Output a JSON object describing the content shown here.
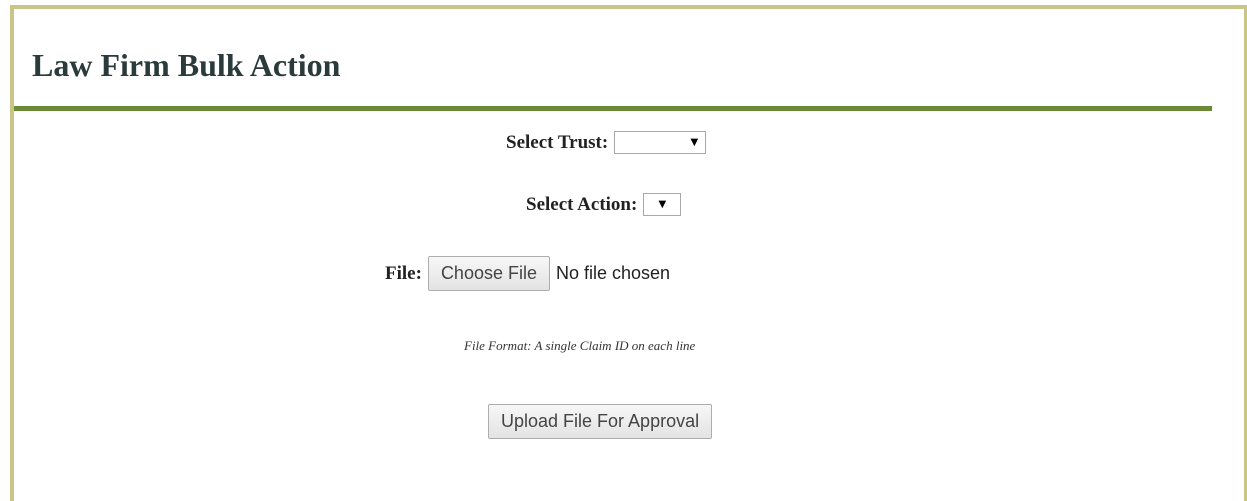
{
  "page": {
    "title": "Law Firm Bulk Action"
  },
  "colors": {
    "frame_border": "#c8c587",
    "title_rule": "#6a8a35",
    "title_text": "#2b3a3a"
  },
  "form": {
    "trust": {
      "label": "Select Trust:",
      "selected_value": "",
      "icon": "caret-down-icon"
    },
    "action": {
      "label": "Select Action:",
      "selected_value": "",
      "icon": "caret-down-icon"
    },
    "file": {
      "label": "File:",
      "button_label": "Choose File",
      "status_text": "No file chosen"
    },
    "format_note": "File Format: A single Claim ID on each line",
    "submit_label": "Upload File For Approval"
  }
}
